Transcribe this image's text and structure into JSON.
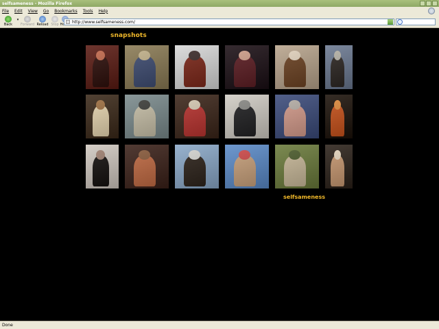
{
  "window": {
    "title": "selfsameness - Mozilla Firefox"
  },
  "menu": [
    "File",
    "Edit",
    "View",
    "Go",
    "Bookmarks",
    "Tools",
    "Help"
  ],
  "toolbar": {
    "back": "Back",
    "forward": "Forward",
    "reload": "Reload",
    "stop": "Stop",
    "home": "Home"
  },
  "address": {
    "url": "http://www.selfsameness.com/"
  },
  "page": {
    "heading": "snapshots",
    "signature": "selfsameness",
    "photos": [
      {
        "name": "photo-couple-dressed-up",
        "colors": [
          "#5a1a12",
          "#2b0c08",
          "#c66a4c"
        ]
      },
      {
        "name": "photo-bookshelf",
        "colors": [
          "#8a7a54",
          "#3c4a70",
          "#c5b48c"
        ]
      },
      {
        "name": "photo-two-in-hats",
        "colors": [
          "#d8d8d8",
          "#7a2416",
          "#3a2a28"
        ]
      },
      {
        "name": "photo-woman-dark",
        "colors": [
          "#1a0e14",
          "#5a1a20",
          "#d2a08a"
        ]
      },
      {
        "name": "photo-man-at-table",
        "colors": [
          "#b8a48c",
          "#6a4020",
          "#e6d6c0"
        ]
      },
      {
        "name": "photo-city-portrait",
        "colors": [
          "#6a7890",
          "#2a2420",
          "#b8b4a8"
        ]
      },
      {
        "name": "photo-child-on-chair",
        "colors": [
          "#3a2818",
          "#e8d6b0",
          "#a07040"
        ]
      },
      {
        "name": "photo-car-palm-tree",
        "colors": [
          "#7a8a8c",
          "#c8c0a8",
          "#3c3c38"
        ]
      },
      {
        "name": "photo-flowers-table",
        "colors": [
          "#3a2418",
          "#b8302c",
          "#d8cbb4"
        ]
      },
      {
        "name": "photo-man-doorway",
        "colors": [
          "#d0ccc4",
          "#1e1e20",
          "#8a8a86"
        ]
      },
      {
        "name": "photo-two-women",
        "colors": [
          "#3a4a7a",
          "#d49a8a",
          "#b8b0a8"
        ]
      },
      {
        "name": "photo-food-platter",
        "colors": [
          "#1a1008",
          "#c85018",
          "#e08a3a"
        ]
      },
      {
        "name": "photo-woman-black",
        "colors": [
          "#d0c8c0",
          "#120e0c",
          "#a08070"
        ]
      },
      {
        "name": "photo-mother-baby",
        "colors": [
          "#3a2018",
          "#c06840",
          "#8a5a3a"
        ]
      },
      {
        "name": "photo-photographer-car",
        "colors": [
          "#8aa8c8",
          "#2a2018",
          "#d8d8d4"
        ]
      },
      {
        "name": "photo-landscape-coast",
        "colors": [
          "#5a8ac8",
          "#c8a07a",
          "#d04848"
        ]
      },
      {
        "name": "photo-child-garden",
        "colors": [
          "#6a7a3a",
          "#c8b898",
          "#4a5a2a"
        ]
      },
      {
        "name": "photo-mother-child",
        "colors": [
          "#2a2018",
          "#c89870",
          "#e8d8c0"
        ]
      }
    ]
  },
  "status": {
    "text": "Done"
  }
}
